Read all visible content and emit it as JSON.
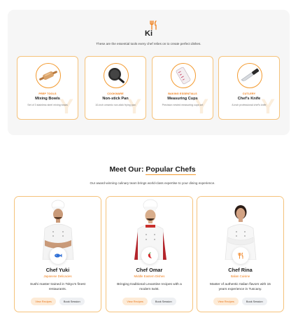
{
  "kitchen": {
    "title": "Ki",
    "subtitle": "These are the essential tools every chef relies on to create perfect dishes.",
    "icon": "fork-knife-icon",
    "tools": [
      {
        "category": "PREP TOOLS",
        "name": "Mixing Bowls",
        "description": "Set of 3 stainless steel mixing bowls",
        "image": "rolling-pin"
      },
      {
        "category": "COOKWARE",
        "name": "Non-stick Pan",
        "description": "10-inch ceramic non-stick frying pan",
        "image": "frying-pan"
      },
      {
        "category": "BAKING ESSENTIALS",
        "name": "Measuring Cups",
        "description": "Precision nested measuring cups set",
        "image": "measuring-cups"
      },
      {
        "category": "CUTLERY",
        "name": "Chef's Knife",
        "description": "8-inch professional chef's knife",
        "image": "chef-knife"
      }
    ]
  },
  "chefs_section": {
    "title_prefix": "Meet Our: ",
    "title_highlight": "Popular Chefs",
    "subtitle": "Our award-winning culinary team brings world-class expertise to your dining experience.",
    "chefs": [
      {
        "name": "Chef Yuki",
        "specialty": "Japanese Delicacies",
        "bio": "Sushi master trained in Tokyo's finest restaurants.",
        "badge_icon": "fish-icon",
        "view_label": "View Recipes",
        "book_label": "Book Session"
      },
      {
        "name": "Chef Omar",
        "specialty": "Middle Eastern Dishes",
        "bio": "Bringing traditional Levantine recipes with a modern twist.",
        "badge_icon": "chili-pepper-icon",
        "view_label": "View Recipes",
        "book_label": "Book Session"
      },
      {
        "name": "Chef Rina",
        "specialty": "Italian Cuisine",
        "bio": "Master of authentic Italian flavors with 15 years experience in Tuscany.",
        "badge_icon": "fork-knife-icon",
        "view_label": "View Recipes",
        "book_label": "Book Session"
      }
    ]
  },
  "colors": {
    "accent": "#f07f1a",
    "card_border": "#f5c27a",
    "panel_bg": "#f6f6f6"
  }
}
